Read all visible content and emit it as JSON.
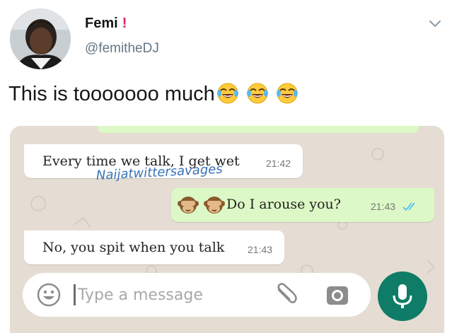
{
  "tweet": {
    "display_name": "Femi",
    "name_suffix": "!",
    "handle": "@femitheDJ",
    "text": "This is tooooooo much",
    "emojis": [
      "face-with-tears-of-joy",
      "face-with-tears-of-joy",
      "face-with-tears-of-joy"
    ],
    "icons": {
      "menu": "chevron-down-icon",
      "avatar": "user-photo"
    }
  },
  "chat": {
    "watermark": "Naijatwittersavages",
    "messages": [
      {
        "direction": "incoming",
        "text": "Every time we talk, I get wet",
        "time": "21:42"
      },
      {
        "direction": "outgoing",
        "prefix_emojis": [
          "see-no-evil-monkey",
          "see-no-evil-monkey"
        ],
        "text": "Do I arouse you?",
        "time": "21:43",
        "status": "read"
      },
      {
        "direction": "incoming",
        "text": "No, you spit when you talk",
        "time": "21:43"
      }
    ],
    "composer": {
      "placeholder": "Type a message",
      "value": "",
      "icons": {
        "emoji": "smiley-icon",
        "attach": "paperclip-icon",
        "camera": "camera-icon",
        "send": "mic-icon"
      }
    }
  },
  "colors": {
    "name_accent": "#e0245e",
    "handle": "#657786",
    "chat_background": "#e5ddd3",
    "incoming_bubble": "#ffffff",
    "outgoing_bubble": "#dcf8c6",
    "read_ticks": "#4fc3f7",
    "mic_button": "#0e7c66",
    "watermark": "#3a73b7"
  }
}
